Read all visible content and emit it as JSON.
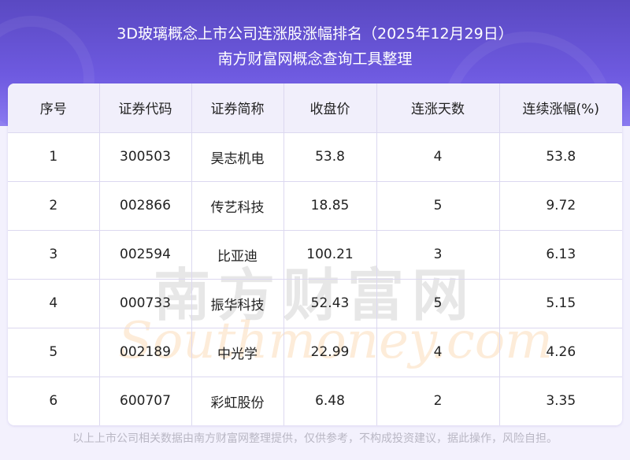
{
  "header": {
    "title": "3D玻璃概念上市公司连涨股涨幅排名（2025年12月29日）",
    "subtitle": "南方财富网概念查询工具整理"
  },
  "table": {
    "columns": [
      "序号",
      "证券代码",
      "证券简称",
      "收盘价",
      "连涨天数",
      "连续涨幅(%)"
    ],
    "rows": [
      [
        "1",
        "300503",
        "昊志机电",
        "53.8",
        "4",
        "53.8"
      ],
      [
        "2",
        "002866",
        "传艺科技",
        "18.85",
        "5",
        "9.72"
      ],
      [
        "3",
        "002594",
        "比亚迪",
        "100.21",
        "3",
        "6.13"
      ],
      [
        "4",
        "000733",
        "振华科技",
        "52.43",
        "5",
        "5.15"
      ],
      [
        "5",
        "002189",
        "中光学",
        "22.99",
        "4",
        "4.26"
      ],
      [
        "6",
        "600707",
        "彩虹股份",
        "6.48",
        "2",
        "3.35"
      ]
    ]
  },
  "watermark": {
    "cn": "南方财富网",
    "en": "Southmoney.com"
  },
  "footer": "以上上市公司相关数据由南方财富网整理提供，仅供参考，不构成投资建议，据此操作，风险自担。"
}
